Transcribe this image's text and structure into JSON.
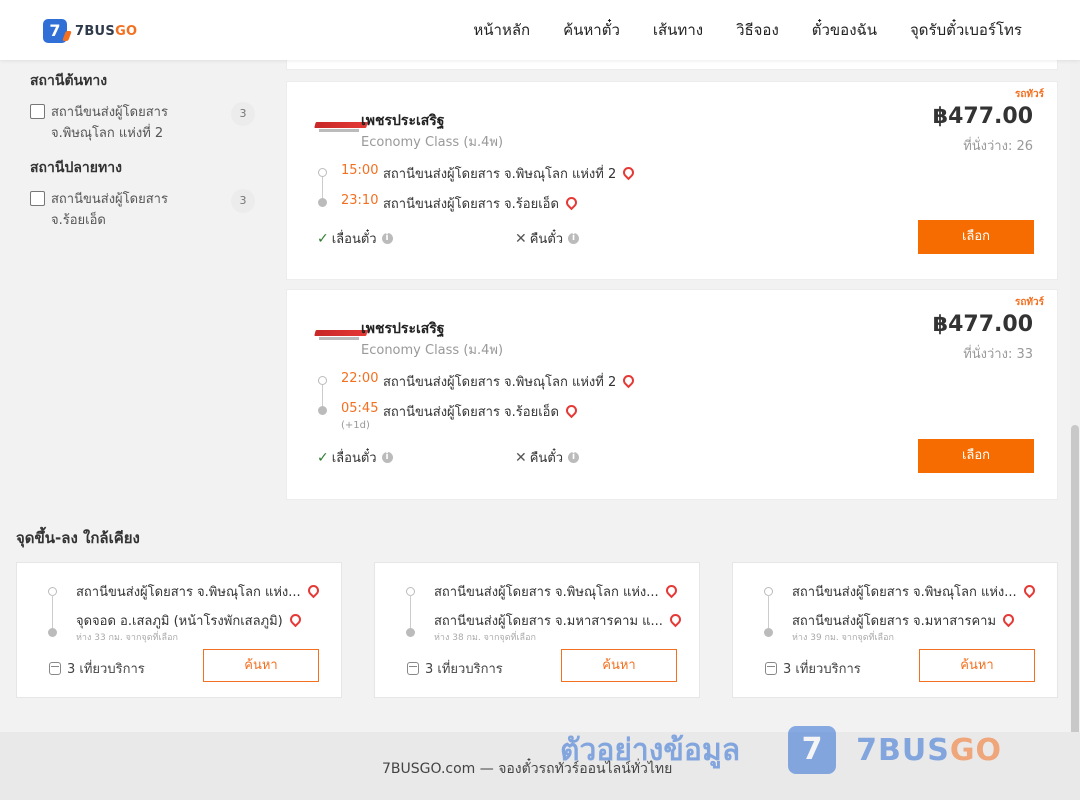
{
  "header": {
    "logo_mark": "7",
    "logo_text_a": "7BUS",
    "logo_text_b": "GO",
    "nav": [
      "หน้าหลัก",
      "ค้นหาตั๋ว",
      "เส้นทาง",
      "วิธีจอง",
      "ตั๋วของฉัน",
      "จุดรับตั๋วเบอร์โทร"
    ]
  },
  "sidebar": {
    "origin": {
      "title": "สถานีต้นทาง",
      "option_line1": "สถานีขนส่งผู้โดยสาร",
      "option_line2": "จ.พิษณุโลก แห่งที่ 2",
      "count": "3"
    },
    "destination": {
      "title": "สถานีปลายทาง",
      "option_line1": "สถานีขนส่งผู้โดยสาร",
      "option_line2": "จ.ร้อยเอ็ด",
      "count": "3"
    }
  },
  "trips": [
    {
      "tag": "รถทัวร์",
      "operator": "เพชรประเสริฐ",
      "class": "Economy Class (ม.4พ)",
      "price": "฿477.00",
      "seats": "ที่นั่งว่าง: 26",
      "depart_time": "15:00",
      "depart_station": "สถานีขนส่งผู้โดยสาร จ.พิษณุโลก แห่งที่ 2",
      "arrive_time": "23:10",
      "arrive_station": "สถานีขนส่งผู้โดยสาร จ.ร้อยเอ็ด",
      "next_day": "",
      "policy_change": "เลื่อนตั๋ว",
      "policy_refund": "คืนตั๋ว",
      "button": "เลือก"
    },
    {
      "tag": "รถทัวร์",
      "operator": "เพชรประเสริฐ",
      "class": "Economy Class (ม.4พ)",
      "price": "฿477.00",
      "seats": "ที่นั่งว่าง: 33",
      "depart_time": "22:00",
      "depart_station": "สถานีขนส่งผู้โดยสาร จ.พิษณุโลก แห่งที่ 2",
      "arrive_time": "05:45",
      "arrive_station": "สถานีขนส่งผู้โดยสาร จ.ร้อยเอ็ด",
      "next_day": "(+1d)",
      "policy_change": "เลื่อนตั๋ว",
      "policy_refund": "คืนตั๋ว",
      "button": "เลือก"
    }
  ],
  "nearby": {
    "title": "จุดขึ้น-ลง ใกล้เคียง",
    "cards": [
      {
        "from": "สถานีขนส่งผู้โดยสาร จ.พิษณุโลก แห่ง...",
        "to": "จุดจอด อ.เสลภูมิ (หน้าโรงพักเสลภูมิ)",
        "distance": "ห่าง 33 กม. จากจุดที่เลือก",
        "trips": "3 เที่ยวบริการ",
        "button": "ค้นหา"
      },
      {
        "from": "สถานีขนส่งผู้โดยสาร จ.พิษณุโลก แห่ง...",
        "to": "สถานีขนส่งผู้โดยสาร จ.มหาสารคาม แ...",
        "distance": "ห่าง 38 กม. จากจุดที่เลือก",
        "trips": "3 เที่ยวบริการ",
        "button": "ค้นหา"
      },
      {
        "from": "สถานีขนส่งผู้โดยสาร จ.พิษณุโลก แห่ง...",
        "to": "สถานีขนส่งผู้โดยสาร จ.มหาสารคาม",
        "distance": "ห่าง 39 กม. จากจุดที่เลือก",
        "trips": "3 เที่ยวบริการ",
        "button": "ค้นหา"
      }
    ]
  },
  "footer": {
    "text": "7BUSGO.com — จองตั๋วรถทัวร์ออนไลน์ทั่วไทย"
  },
  "watermark": {
    "thai": "ตัวอย่างข้อมูล",
    "badge": "7",
    "brand_a": "7BUS",
    "brand_b": "GO"
  },
  "colors": {
    "accent_orange": "#f76c00",
    "brand_blue": "#2f6fd6",
    "pin_red": "#e53935",
    "check_green": "#2e7d32"
  }
}
